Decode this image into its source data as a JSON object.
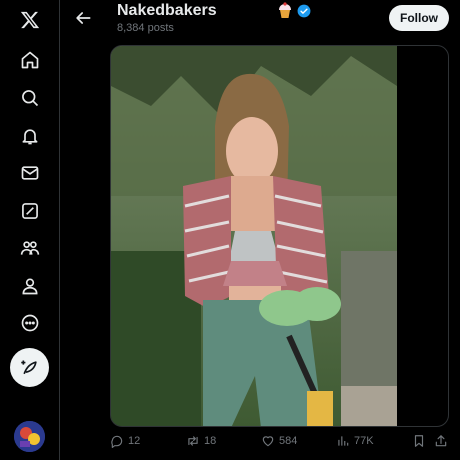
{
  "header": {
    "display_name": "Nakedbakers",
    "post_count": "8,384 posts",
    "follow_label": "Follow"
  },
  "sidebar": {
    "items": [
      {
        "icon": "x-logo-icon"
      },
      {
        "icon": "home-icon"
      },
      {
        "icon": "search-icon"
      },
      {
        "icon": "notifications-bell-icon"
      },
      {
        "icon": "messages-envelope-icon"
      },
      {
        "icon": "grok-icon"
      },
      {
        "icon": "communities-icon"
      },
      {
        "icon": "profile-icon"
      },
      {
        "icon": "more-circle-icon"
      },
      {
        "icon": "compose-post-icon"
      }
    ]
  },
  "post": {
    "replies": "12",
    "reposts": "18",
    "likes": "584",
    "views": "77K"
  },
  "colors": {
    "background": "#000000",
    "verified_badge": "#1d9bf0",
    "secondary_text": "#71767b",
    "follow_button_bg": "#eff3f4"
  }
}
